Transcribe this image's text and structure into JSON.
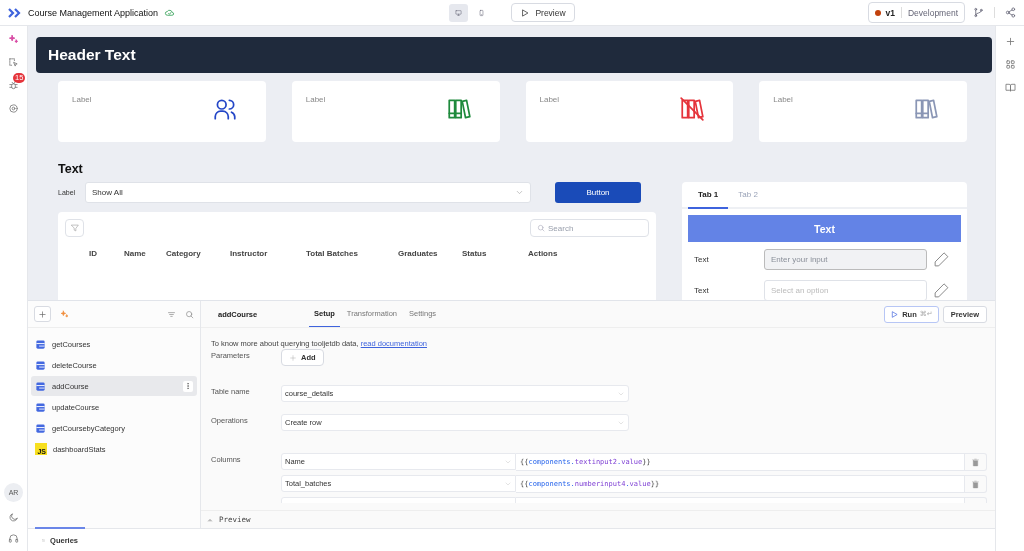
{
  "app": {
    "title": "Course Management Application"
  },
  "toolbar": {
    "view_modes": [
      {
        "kind": "desktop",
        "selected": true
      },
      {
        "kind": "mobile",
        "selected": false
      }
    ],
    "preview": "Preview",
    "version": "v1",
    "environment": "Development"
  },
  "left_rail": {
    "badge": "15",
    "avatar": "AR"
  },
  "canvas": {
    "header": "Header Text",
    "stat_cards": [
      {
        "label": "Label",
        "kind": "users",
        "color": "#2447c7"
      },
      {
        "label": "Label",
        "kind": "books",
        "color": "#1e8a3c"
      },
      {
        "label": "Label",
        "kind": "books-off",
        "color": "#e5343b"
      },
      {
        "label": "Label",
        "kind": "books",
        "color": "#8a96b5"
      }
    ],
    "heading": "Text",
    "filter": {
      "label": "Label",
      "value": "Show All"
    },
    "button": "Button",
    "table": {
      "search_placeholder": "Search",
      "columns": [
        "ID",
        "Name",
        "Category",
        "Instructor",
        "Total Batches",
        "Graduates",
        "Status",
        "Actions"
      ]
    },
    "tabs_panel": {
      "tabs": [
        {
          "label": "Tab 1",
          "selected": true
        },
        {
          "label": "Tab 2",
          "selected": false
        }
      ],
      "banner": "Text",
      "rows": [
        {
          "label": "Text",
          "kind": "input",
          "placeholder": "Enter your input"
        },
        {
          "label": "Text",
          "kind": "select",
          "placeholder": "Select an option"
        }
      ]
    }
  },
  "queries": {
    "items": [
      {
        "name": "getCourses",
        "kind": "db",
        "selected": false
      },
      {
        "name": "deleteCourse",
        "kind": "db",
        "selected": false
      },
      {
        "name": "addCourse",
        "kind": "db",
        "selected": true
      },
      {
        "name": "updateCourse",
        "kind": "db",
        "selected": false
      },
      {
        "name": "getCoursebyCategory",
        "kind": "db",
        "selected": false
      },
      {
        "name": "dashboardStats",
        "kind": "js",
        "badge": "JS",
        "selected": false
      }
    ]
  },
  "editor": {
    "query_name": "addCourse",
    "tabs": [
      {
        "label": "Setup",
        "selected": true
      },
      {
        "label": "Transformation",
        "selected": false
      },
      {
        "label": "Settings",
        "selected": false
      }
    ],
    "run": "Run",
    "run_shortcut": "⌘↵",
    "preview": "Preview",
    "info": "To know more about querying tooljetdb data, ",
    "info_link": "read documentation",
    "parameters_label": "Parameters",
    "add_button": "Add",
    "table_name_label": "Table name",
    "table_name": "course_details",
    "operations_label": "Operations",
    "operation": "Create row",
    "columns_label": "Columns",
    "columns": [
      {
        "column": "Name",
        "value": "{{components.textinput2.value}}"
      },
      {
        "column": "Total_batches",
        "value": "{{components.numberinput4.value}}"
      }
    ],
    "preview_bar": "Preview"
  },
  "bottom_tab": {
    "label": "Queries",
    "selected": true
  }
}
